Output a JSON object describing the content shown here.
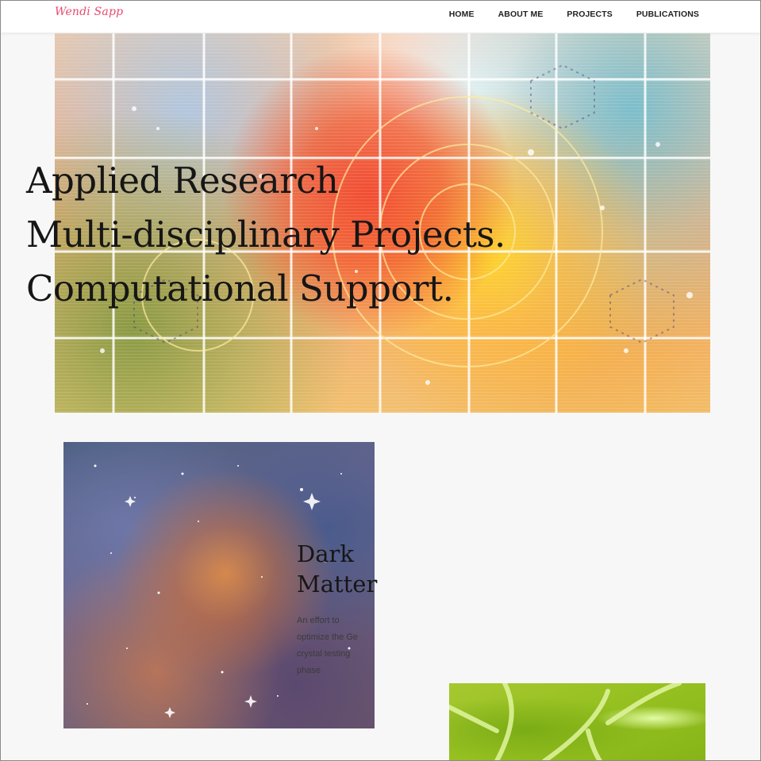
{
  "site": {
    "logo_text": "Wendi Sapp",
    "accent_color": "#e8496e"
  },
  "nav": {
    "items": [
      {
        "label": "HOME"
      },
      {
        "label": "ABOUT ME"
      },
      {
        "label": "PROJECTS"
      },
      {
        "label": "PUBLICATIONS"
      }
    ]
  },
  "hero": {
    "lines": [
      "Applied Research",
      "Multi-disciplinary Projects.",
      "Computational Support."
    ],
    "image": "abstract-science-grid-image"
  },
  "projects": [
    {
      "title_lines": [
        "Dark",
        "Matter"
      ],
      "description": "An effort to optimize the Ge crystal testing phase",
      "image": "nebula-space-image"
    },
    {
      "image": "green-leaf-image"
    }
  ]
}
